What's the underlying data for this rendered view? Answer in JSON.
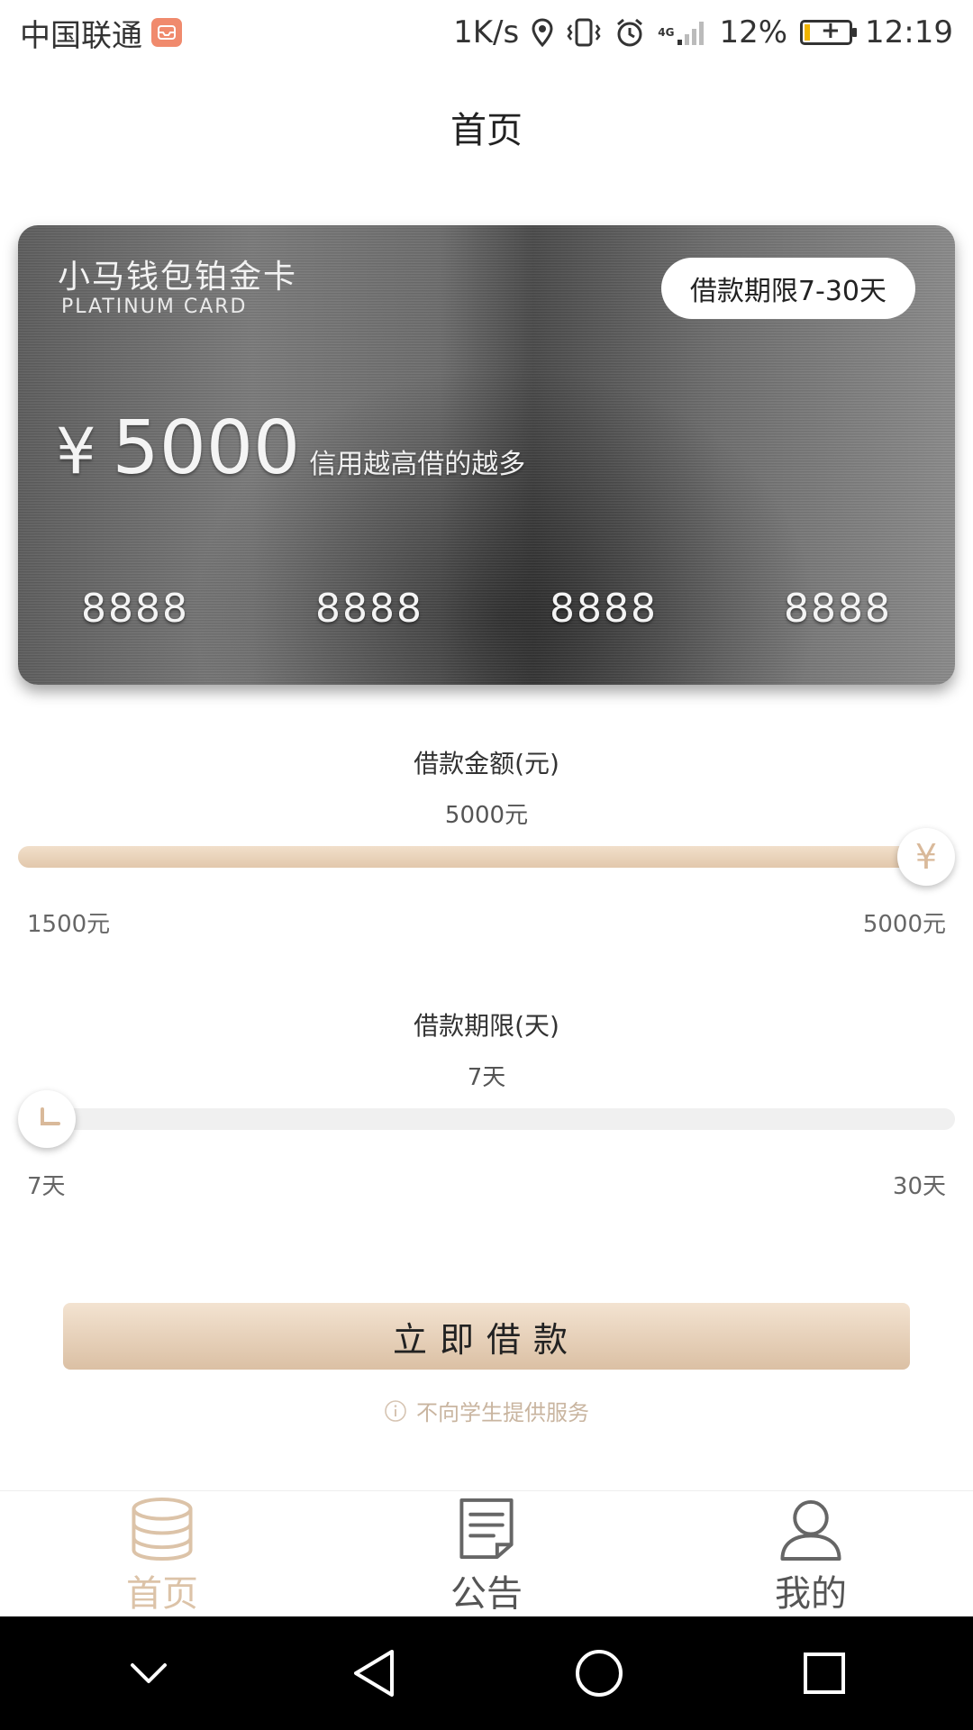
{
  "status_bar": {
    "carrier": "中国联通",
    "net_speed": "1K/s",
    "signal_type": "4G",
    "battery_percent": "12%",
    "battery_level": 0.12,
    "time": "12:19"
  },
  "header": {
    "title": "首页"
  },
  "card": {
    "name": "小马钱包铂金卡",
    "subtitle": "PLATINUM CARD",
    "term_badge": "借款期限7-30天",
    "currency_symbol": "¥",
    "amount": "5000",
    "slogan": "信用越高借的越多",
    "numbers": [
      "8888",
      "8888",
      "8888",
      "8888"
    ]
  },
  "amount_slider": {
    "label": "借款金额(元)",
    "value_text": "5000元",
    "min_label": "1500元",
    "max_label": "5000元",
    "thumb_symbol": "¥",
    "min": 1500,
    "max": 5000,
    "value": 5000
  },
  "term_slider": {
    "label": "借款期限(天)",
    "value_text": "7天",
    "min_label": "7天",
    "max_label": "30天",
    "min": 7,
    "max": 30,
    "value": 7
  },
  "cta": {
    "label": "立即借款"
  },
  "notice": {
    "text": "不向学生提供服务"
  },
  "tabs": [
    {
      "label": "首页",
      "icon": "coins-stack-icon",
      "active": true
    },
    {
      "label": "公告",
      "icon": "document-icon",
      "active": false
    },
    {
      "label": "我的",
      "icon": "user-icon",
      "active": false
    }
  ],
  "colors": {
    "accent": "#dcc3a8",
    "button_top": "#f3e3d1",
    "button_bottom": "#dbc0a4",
    "track_bg": "#f0f0f0"
  }
}
